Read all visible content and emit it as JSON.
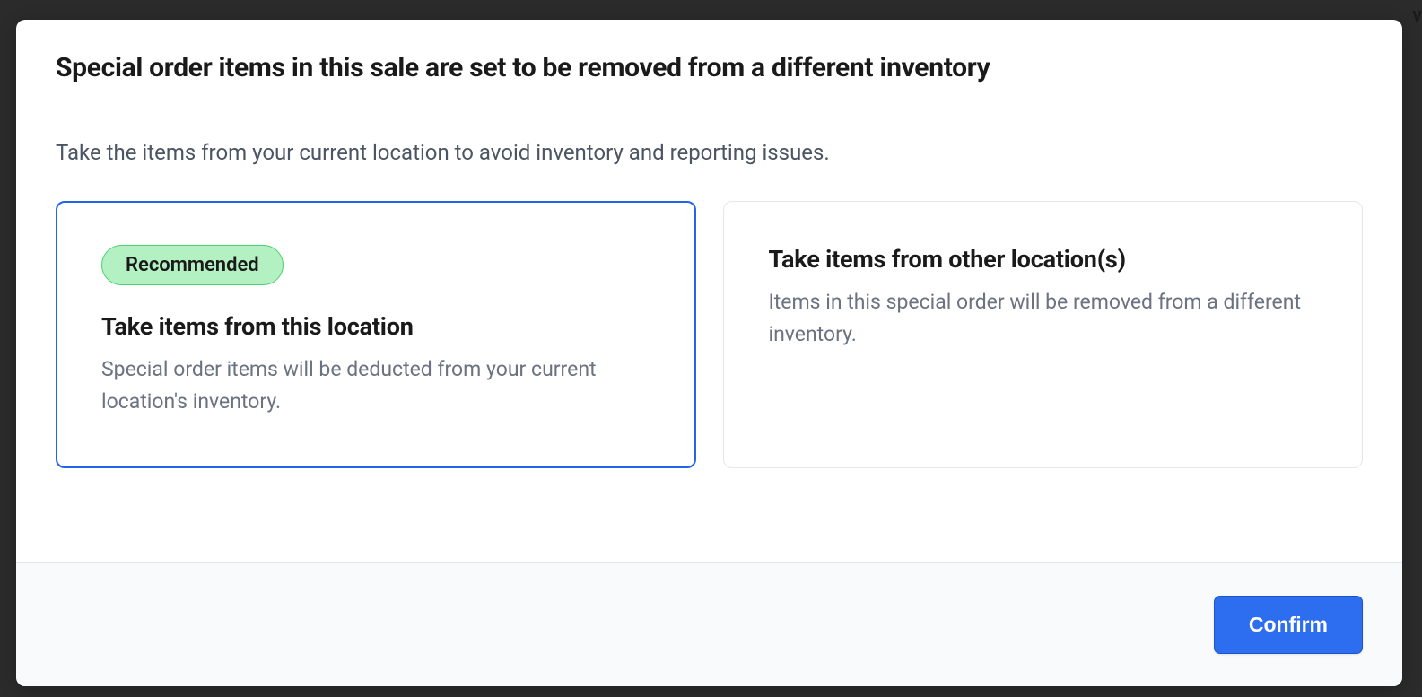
{
  "backdrop": {
    "partial_text": "v"
  },
  "modal": {
    "title": "Special order items in this sale are set to be removed from a different inventory",
    "instruction": "Take the items from your current location to avoid inventory and reporting issues.",
    "options": [
      {
        "badge": "Recommended",
        "title": "Take items from this location",
        "description": "Special order items will be deducted from your current location's inventory.",
        "selected": true
      },
      {
        "title": "Take items from other location(s)",
        "description": "Items in this special order will be removed from a different inventory.",
        "selected": false
      }
    ],
    "footer": {
      "confirm_label": "Confirm"
    }
  }
}
